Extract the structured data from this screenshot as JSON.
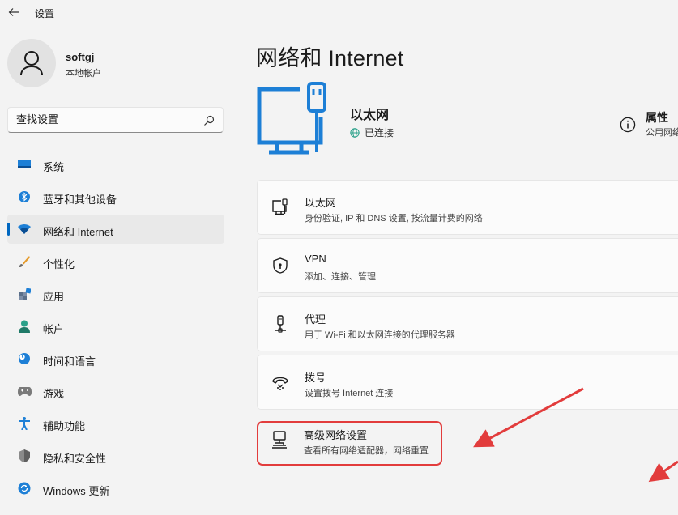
{
  "window": {
    "title": "设置"
  },
  "profile": {
    "name": "softgj",
    "account_type": "本地帐户"
  },
  "search": {
    "placeholder": "查找设置"
  },
  "nav": {
    "items": [
      {
        "label": "系统",
        "icon": "display-icon"
      },
      {
        "label": "蓝牙和其他设备",
        "icon": "bluetooth-icon"
      },
      {
        "label": "网络和 Internet",
        "icon": "wifi-icon",
        "active": true
      },
      {
        "label": "个性化",
        "icon": "brush-icon"
      },
      {
        "label": "应用",
        "icon": "apps-icon"
      },
      {
        "label": "帐户",
        "icon": "person-icon"
      },
      {
        "label": "时间和语言",
        "icon": "clock-globe-icon"
      },
      {
        "label": "游戏",
        "icon": "gamepad-icon"
      },
      {
        "label": "辅助功能",
        "icon": "accessibility-icon"
      },
      {
        "label": "隐私和安全性",
        "icon": "shield-icon"
      },
      {
        "label": "Windows 更新",
        "icon": "update-icon"
      }
    ]
  },
  "main": {
    "title": "网络和 Internet",
    "connection": {
      "name": "以太网",
      "status": "已连接"
    },
    "properties": {
      "title": "属性",
      "subtitle": "公用网络"
    },
    "cards": [
      {
        "title": "以太网",
        "subtitle": "身份验证, IP 和 DNS 设置, 按流量计费的网络",
        "icon": "ethernet-icon"
      },
      {
        "title": "VPN",
        "subtitle": "添加、连接、管理",
        "icon": "vpn-shield-icon"
      },
      {
        "title": "代理",
        "subtitle": "用于 Wi-Fi 和以太网连接的代理服务器",
        "icon": "proxy-icon"
      },
      {
        "title": "拨号",
        "subtitle": "设置拨号 Internet 连接",
        "icon": "dialup-icon"
      },
      {
        "title": "高级网络设置",
        "subtitle": "查看所有网络适配器，网络重置",
        "icon": "advanced-network-icon"
      }
    ]
  },
  "colors": {
    "accent": "#0067c0",
    "annotation": "#e23c3c",
    "background": "#f3f3f3"
  }
}
